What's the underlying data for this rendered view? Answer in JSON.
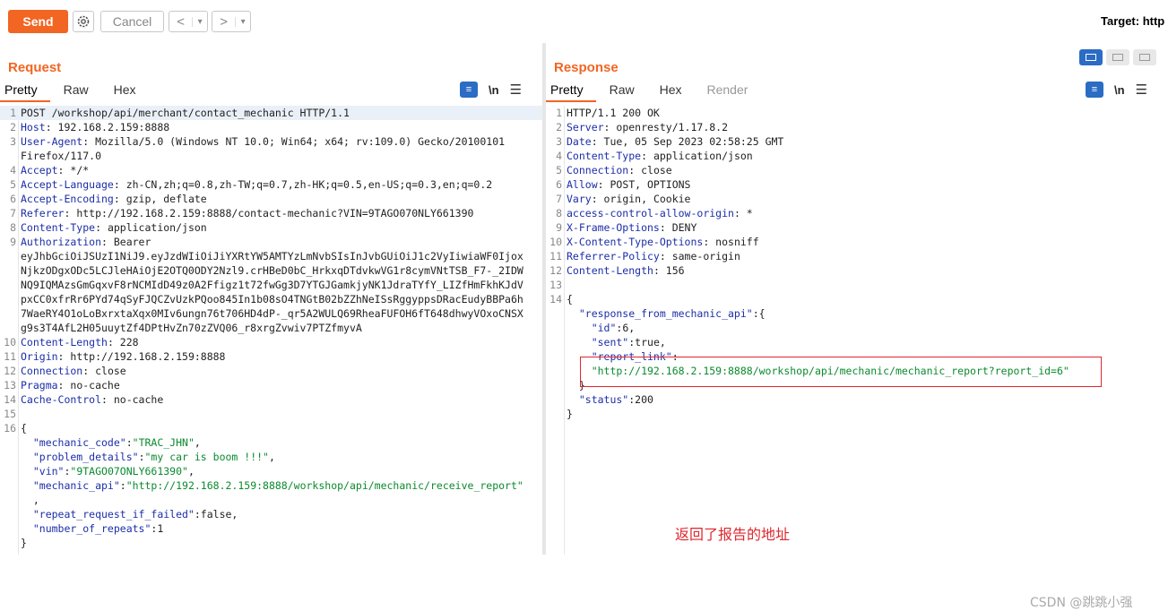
{
  "toolbar": {
    "send_label": "Send",
    "cancel_label": "Cancel",
    "back_label": "<",
    "forward_label": ">",
    "dropdown_label": "▾",
    "target_label": "Target: http"
  },
  "request": {
    "title": "Request",
    "tabs": [
      "Pretty",
      "Raw",
      "Hex"
    ],
    "newline_label": "\\n",
    "lines": [
      {
        "n": "1",
        "parts": [
          [
            "POST /workshop/api/merchant/contact_mechanic HTTP/1.1",
            "p"
          ]
        ]
      },
      {
        "n": "2",
        "parts": [
          [
            "Host",
            "k"
          ],
          [
            ": 192.168.2.159:8888",
            "p"
          ]
        ]
      },
      {
        "n": "3",
        "parts": [
          [
            "User-Agent",
            "k"
          ],
          [
            ": Mozilla/5.0 (Windows NT 10.0; Win64; x64; rv:109.0) Gecko/20100101",
            "p"
          ]
        ]
      },
      {
        "n": "",
        "parts": [
          [
            "Firefox/117.0",
            "p"
          ]
        ]
      },
      {
        "n": "4",
        "parts": [
          [
            "Accept",
            "k"
          ],
          [
            ": */*",
            "p"
          ]
        ]
      },
      {
        "n": "5",
        "parts": [
          [
            "Accept-Language",
            "k"
          ],
          [
            ": zh-CN,zh;q=0.8,zh-TW;q=0.7,zh-HK;q=0.5,en-US;q=0.3,en;q=0.2",
            "p"
          ]
        ]
      },
      {
        "n": "6",
        "parts": [
          [
            "Accept-Encoding",
            "k"
          ],
          [
            ": gzip, deflate",
            "p"
          ]
        ]
      },
      {
        "n": "7",
        "parts": [
          [
            "Referer",
            "k"
          ],
          [
            ": http://192.168.2.159:8888/contact-mechanic?VIN=9TAGO070NLY661390",
            "p"
          ]
        ]
      },
      {
        "n": "8",
        "parts": [
          [
            "Content-Type",
            "k"
          ],
          [
            ": application/json",
            "p"
          ]
        ]
      },
      {
        "n": "9",
        "parts": [
          [
            "Authorization",
            "k"
          ],
          [
            ": Bearer",
            "p"
          ]
        ]
      },
      {
        "n": "",
        "parts": [
          [
            "eyJhbGciOiJSUzI1NiJ9.eyJzdWIiOiJiYXRtYW5AMTYzLmNvbSIsInJvbGUiOiJ1c2VyIiwiaWF0Ijox",
            "p"
          ]
        ]
      },
      {
        "n": "",
        "parts": [
          [
            "NjkzODgxODc5LCJleHAiOjE2OTQ0ODY2Nzl9.crHBeD0bC_HrkxqDTdvkwVG1r8cymVNtTSB_F7-_2IDW",
            "p"
          ]
        ]
      },
      {
        "n": "",
        "parts": [
          [
            "NQ9IQMAzsGmGqxvF8rNCMIdD49z0A2Ffigz1t72fwGg3D7YTGJGamkjyNK1JdraTYfY_LIZfHmFkhKJdV",
            "p"
          ]
        ]
      },
      {
        "n": "",
        "parts": [
          [
            "pxCC0xfrRr6PYd74qSyFJQCZvUzkPQoo845In1b08sO4TNGtB02bZZhNeISsRggyppsDRacEudyBBPa6h",
            "p"
          ]
        ]
      },
      {
        "n": "",
        "parts": [
          [
            "7WaeRY4O1oLoBxrxtaXqx0MIv6ungn76t706HD4dP-_qr5A2WULQ69RheaFUFOH6fT648dhwyVOxoCNSX",
            "p"
          ]
        ]
      },
      {
        "n": "",
        "parts": [
          [
            "g9s3T4AfL2H05uuytZf4DPtHvZn70zZVQ06_r8xrgZvwiv7PTZfmyvA",
            "p"
          ]
        ]
      },
      {
        "n": "10",
        "parts": [
          [
            "Content-Length",
            "k"
          ],
          [
            ": 228",
            "p"
          ]
        ]
      },
      {
        "n": "11",
        "parts": [
          [
            "Origin",
            "k"
          ],
          [
            ": http://192.168.2.159:8888",
            "p"
          ]
        ]
      },
      {
        "n": "12",
        "parts": [
          [
            "Connection",
            "k"
          ],
          [
            ": close",
            "p"
          ]
        ]
      },
      {
        "n": "13",
        "parts": [
          [
            "Pragma",
            "k"
          ],
          [
            ": no-cache",
            "p"
          ]
        ]
      },
      {
        "n": "14",
        "parts": [
          [
            "Cache-Control",
            "k"
          ],
          [
            ": no-cache",
            "p"
          ]
        ]
      },
      {
        "n": "15",
        "parts": []
      },
      {
        "n": "16",
        "parts": [
          [
            "{",
            "p"
          ]
        ]
      },
      {
        "n": "",
        "parts": [
          [
            "  \"mechanic_code\"",
            "k"
          ],
          [
            ":",
            "p"
          ],
          [
            "\"TRAC_JHN\"",
            "s"
          ],
          [
            ",",
            "p"
          ]
        ]
      },
      {
        "n": "",
        "parts": [
          [
            "  \"problem_details\"",
            "k"
          ],
          [
            ":",
            "p"
          ],
          [
            "\"my car is boom !!!\"",
            "s"
          ],
          [
            ",",
            "p"
          ]
        ]
      },
      {
        "n": "",
        "parts": [
          [
            "  \"vin\"",
            "k"
          ],
          [
            ":",
            "p"
          ],
          [
            "\"9TAGO07ONLY661390\"",
            "s"
          ],
          [
            ",",
            "p"
          ]
        ]
      },
      {
        "n": "",
        "parts": [
          [
            "  \"mechanic_api\"",
            "k"
          ],
          [
            ":",
            "p"
          ],
          [
            "\"http://192.168.2.159:8888/workshop/api/mechanic/receive_report\"",
            "s"
          ]
        ]
      },
      {
        "n": "",
        "parts": [
          [
            "  ,",
            "p"
          ]
        ]
      },
      {
        "n": "",
        "parts": [
          [
            "  \"repeat_request_if_failed\"",
            "k"
          ],
          [
            ":false,",
            "p"
          ]
        ]
      },
      {
        "n": "",
        "parts": [
          [
            "  \"number_of_repeats\"",
            "k"
          ],
          [
            ":1",
            "p"
          ]
        ]
      },
      {
        "n": "",
        "parts": [
          [
            "}",
            "p"
          ]
        ]
      }
    ]
  },
  "response": {
    "title": "Response",
    "tabs": [
      "Pretty",
      "Raw",
      "Hex",
      "Render"
    ],
    "newline_label": "\\n",
    "lines": [
      {
        "n": "1",
        "parts": [
          [
            "HTTP/1.1 200 OK",
            "p"
          ]
        ]
      },
      {
        "n": "2",
        "parts": [
          [
            "Server",
            "k"
          ],
          [
            ": openresty/1.17.8.2",
            "p"
          ]
        ]
      },
      {
        "n": "3",
        "parts": [
          [
            "Date",
            "k"
          ],
          [
            ": Tue, 05 Sep 2023 02:58:25 GMT",
            "p"
          ]
        ]
      },
      {
        "n": "4",
        "parts": [
          [
            "Content-Type",
            "k"
          ],
          [
            ": application/json",
            "p"
          ]
        ]
      },
      {
        "n": "5",
        "parts": [
          [
            "Connection",
            "k"
          ],
          [
            ": close",
            "p"
          ]
        ]
      },
      {
        "n": "6",
        "parts": [
          [
            "Allow",
            "k"
          ],
          [
            ": POST, OPTIONS",
            "p"
          ]
        ]
      },
      {
        "n": "7",
        "parts": [
          [
            "Vary",
            "k"
          ],
          [
            ": origin, Cookie",
            "p"
          ]
        ]
      },
      {
        "n": "8",
        "parts": [
          [
            "access-control-allow-origin",
            "k"
          ],
          [
            ": *",
            "p"
          ]
        ]
      },
      {
        "n": "9",
        "parts": [
          [
            "X-Frame-Options",
            "k"
          ],
          [
            ": DENY",
            "p"
          ]
        ]
      },
      {
        "n": "10",
        "parts": [
          [
            "X-Content-Type-Options",
            "k"
          ],
          [
            ": nosniff",
            "p"
          ]
        ]
      },
      {
        "n": "11",
        "parts": [
          [
            "Referrer-Policy",
            "k"
          ],
          [
            ": same-origin",
            "p"
          ]
        ]
      },
      {
        "n": "12",
        "parts": [
          [
            "Content-Length",
            "k"
          ],
          [
            ": 156",
            "p"
          ]
        ]
      },
      {
        "n": "13",
        "parts": []
      },
      {
        "n": "14",
        "parts": [
          [
            "{",
            "p"
          ]
        ]
      },
      {
        "n": "",
        "parts": [
          [
            "  \"response_from_mechanic_api\"",
            "k"
          ],
          [
            ":{",
            "p"
          ]
        ]
      },
      {
        "n": "",
        "parts": [
          [
            "    \"id\"",
            "k"
          ],
          [
            ":6,",
            "p"
          ]
        ]
      },
      {
        "n": "",
        "parts": [
          [
            "    \"sent\"",
            "k"
          ],
          [
            ":true,",
            "p"
          ]
        ]
      },
      {
        "n": "",
        "parts": [
          [
            "    \"report_link\"",
            "k"
          ],
          [
            ":",
            "p"
          ]
        ]
      },
      {
        "n": "",
        "parts": [
          [
            "    \"http://192.168.2.159:8888/workshop/api/mechanic/mechanic_report?report_id=6\"",
            "s"
          ]
        ]
      },
      {
        "n": "",
        "parts": [
          [
            "  }",
            "p"
          ]
        ]
      },
      {
        "n": "",
        "parts": [
          [
            "  \"status\"",
            "k"
          ],
          [
            ":200",
            "p"
          ]
        ]
      },
      {
        "n": "",
        "parts": [
          [
            "}",
            "p"
          ]
        ]
      }
    ]
  },
  "annotation": "返回了报告的地址",
  "watermark": "CSDN @跳跳小强",
  "colors": {
    "accent": "#f26522",
    "key": "#1c2ea8",
    "string": "#0b8a2e",
    "highlight": "#e0262d",
    "toggle": "#2b6cc4"
  }
}
